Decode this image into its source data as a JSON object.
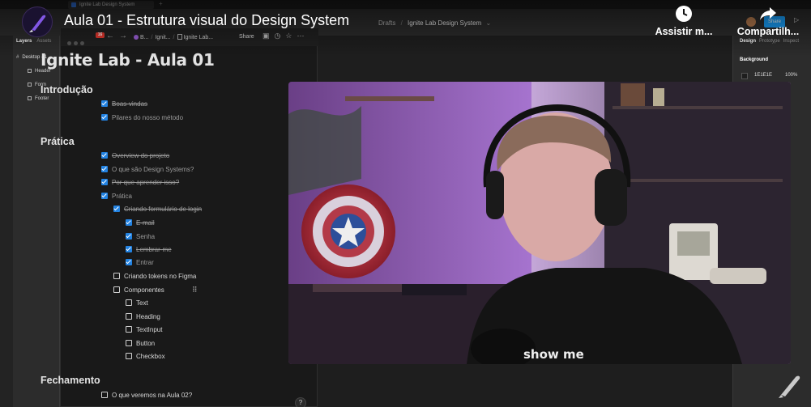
{
  "figma": {
    "tab_title": "Ignite Lab Design System",
    "breadcrumb_drafts": "Drafts",
    "breadcrumb_sep": "/",
    "file_name": "Ignite Lab Design System",
    "share_label": "Share",
    "left_tabs": [
      "Layers",
      "Assets"
    ],
    "layers": {
      "frame": "Desktop - 1",
      "children": [
        "Header",
        "Form",
        "Footer"
      ]
    },
    "right_tabs": [
      "Design",
      "Prototype",
      "Inspect"
    ],
    "background_label": "Background",
    "background_hex": "1E1E1E",
    "background_opacity": "100%"
  },
  "notion": {
    "notification_count": "16",
    "breadcrumbs": [
      "B...",
      "Ignit...",
      "Ignite Lab..."
    ],
    "share_label": "Share",
    "page_title": "Ignite Lab - Aula 01",
    "sections": {
      "intro": "Introdução",
      "pratica": "Prática",
      "fechamento": "Fechamento"
    },
    "todos": {
      "boas_vindas": "Boas-vindas",
      "pilares": "Pilares do nosso método",
      "overview": "Overview do projeto",
      "o_que_sao": "O que são Design Systems?",
      "por_que": "Por que aprender isso?",
      "pratica": "Prática",
      "criando_form": "Criando formulário de login",
      "email": "E-mail",
      "senha": "Senha",
      "lembrar": "Lembrar-me",
      "entrar": "Entrar",
      "tokens": "Criando tokens no Figma",
      "componentes": "Componentes",
      "text": "Text",
      "heading": "Heading",
      "textinput": "TextInput",
      "button": "Button",
      "checkbox": "Checkbox",
      "aula02": "O que veremos na Aula 02?"
    },
    "help_label": "?"
  },
  "player": {
    "video_title": "Aula 01 - Estrutura visual do Design System",
    "watch_later_label": "Assistir m...",
    "share_label": "Compartilh..."
  },
  "webcam": {
    "shirt_text": "show me"
  },
  "colors": {
    "checkbox_blue": "#2383e2",
    "figma_share_blue": "#18a0fb",
    "notification_red": "#e2372e"
  }
}
